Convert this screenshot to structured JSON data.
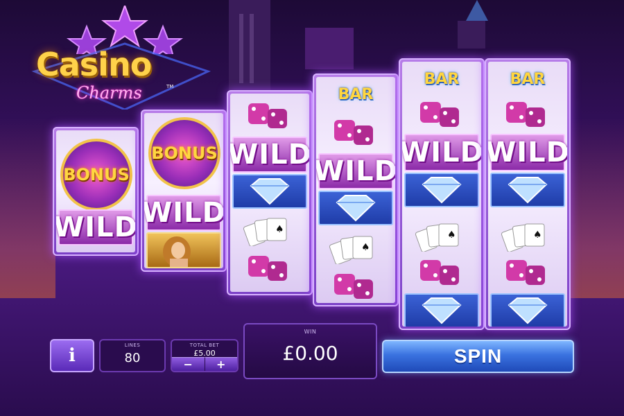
{
  "logo": {
    "main": "Casino",
    "sub": "Charms",
    "tm": "TM"
  },
  "reels": [
    {
      "id": 1,
      "symbols": [
        "bonus",
        "wild"
      ]
    },
    {
      "id": 2,
      "symbols": [
        "bonus",
        "wild",
        "lady"
      ]
    },
    {
      "id": 3,
      "symbols": [
        "dice",
        "wild",
        "diamond",
        "cards",
        "dice"
      ]
    },
    {
      "id": 4,
      "symbols": [
        "bar",
        "dice",
        "wild",
        "diamond",
        "cards",
        "dice"
      ]
    },
    {
      "id": 5,
      "symbols": [
        "bar",
        "dice",
        "wild",
        "diamond",
        "cards",
        "dice",
        "diamond"
      ]
    },
    {
      "id": 6,
      "symbols": [
        "bar",
        "dice",
        "wild",
        "diamond",
        "cards",
        "dice",
        "diamond"
      ]
    }
  ],
  "symbol_text": {
    "wild": "WILD",
    "bar": "BAR",
    "bonus": "BONUS"
  },
  "controls": {
    "info_label": "i",
    "lines_label": "LINES",
    "lines_value": "80",
    "bet_label": "TOTAL BET",
    "bet_value": "£5.00",
    "bet_minus": "−",
    "bet_plus": "+",
    "win_label": "WIN",
    "win_value": "£0.00",
    "spin_label": "SPIN"
  },
  "colors": {
    "accent": "#7a3fc6",
    "spin": "#3a72e0",
    "gold": "#ffd24a"
  }
}
